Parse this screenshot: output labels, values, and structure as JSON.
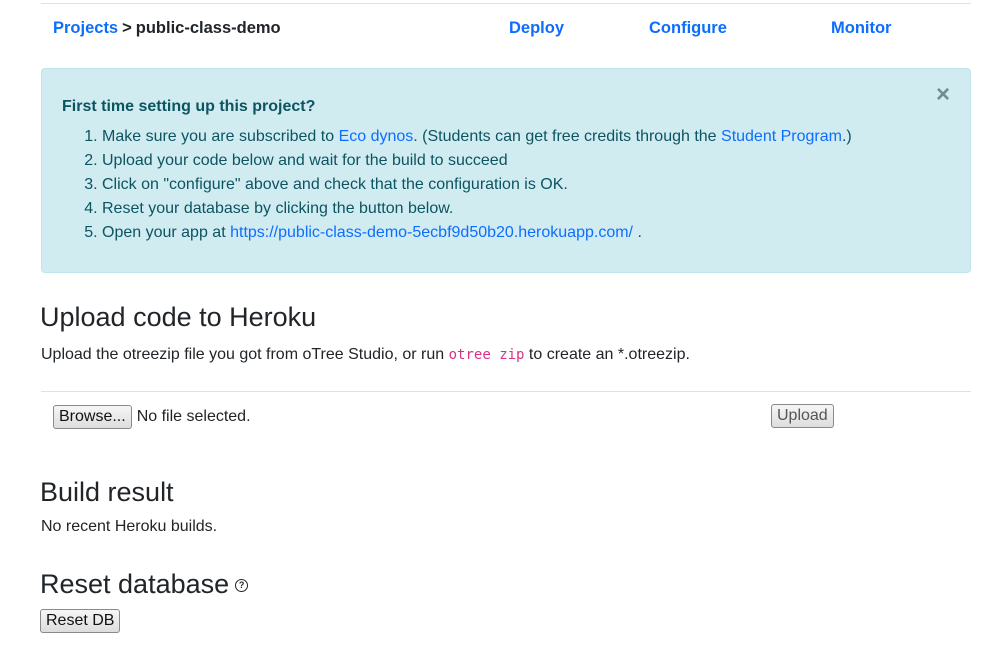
{
  "nav": {
    "projects": "Projects",
    "separator": ">",
    "project_name": "public-class-demo",
    "deploy": "Deploy",
    "configure": "Configure",
    "monitor": "Monitor"
  },
  "alert": {
    "close": "×",
    "heading": "First time setting up this project?",
    "step1_pre": "Make sure you are subscribed to ",
    "step1_link1": "Eco dynos",
    "step1_mid": ". (Students can get free credits through the ",
    "step1_link2": "Student Program",
    "step1_post": ".)",
    "step2": "Upload your code below and wait for the build to succeed",
    "step3": "Click on \"configure\" above and check that the configuration is OK.",
    "step4": "Reset your database by clicking the button below.",
    "step5_pre": "Open your app at ",
    "step5_link": "https://public-class-demo-5ecbf9d50b20.herokuapp.com/",
    "step5_post": " ."
  },
  "upload": {
    "title": "Upload code to Heroku",
    "desc_pre": "Upload the otreezip file you got from oTree Studio, or run ",
    "desc_code": "otree zip",
    "desc_post": " to create an *.otreezip.",
    "browse_label": "Browse...",
    "file_status": "No file selected.",
    "upload_label": "Upload"
  },
  "build": {
    "title": "Build result",
    "text": "No recent Heroku builds."
  },
  "reset": {
    "title": "Reset database",
    "help_icon": "?",
    "button_label": "Reset DB"
  }
}
